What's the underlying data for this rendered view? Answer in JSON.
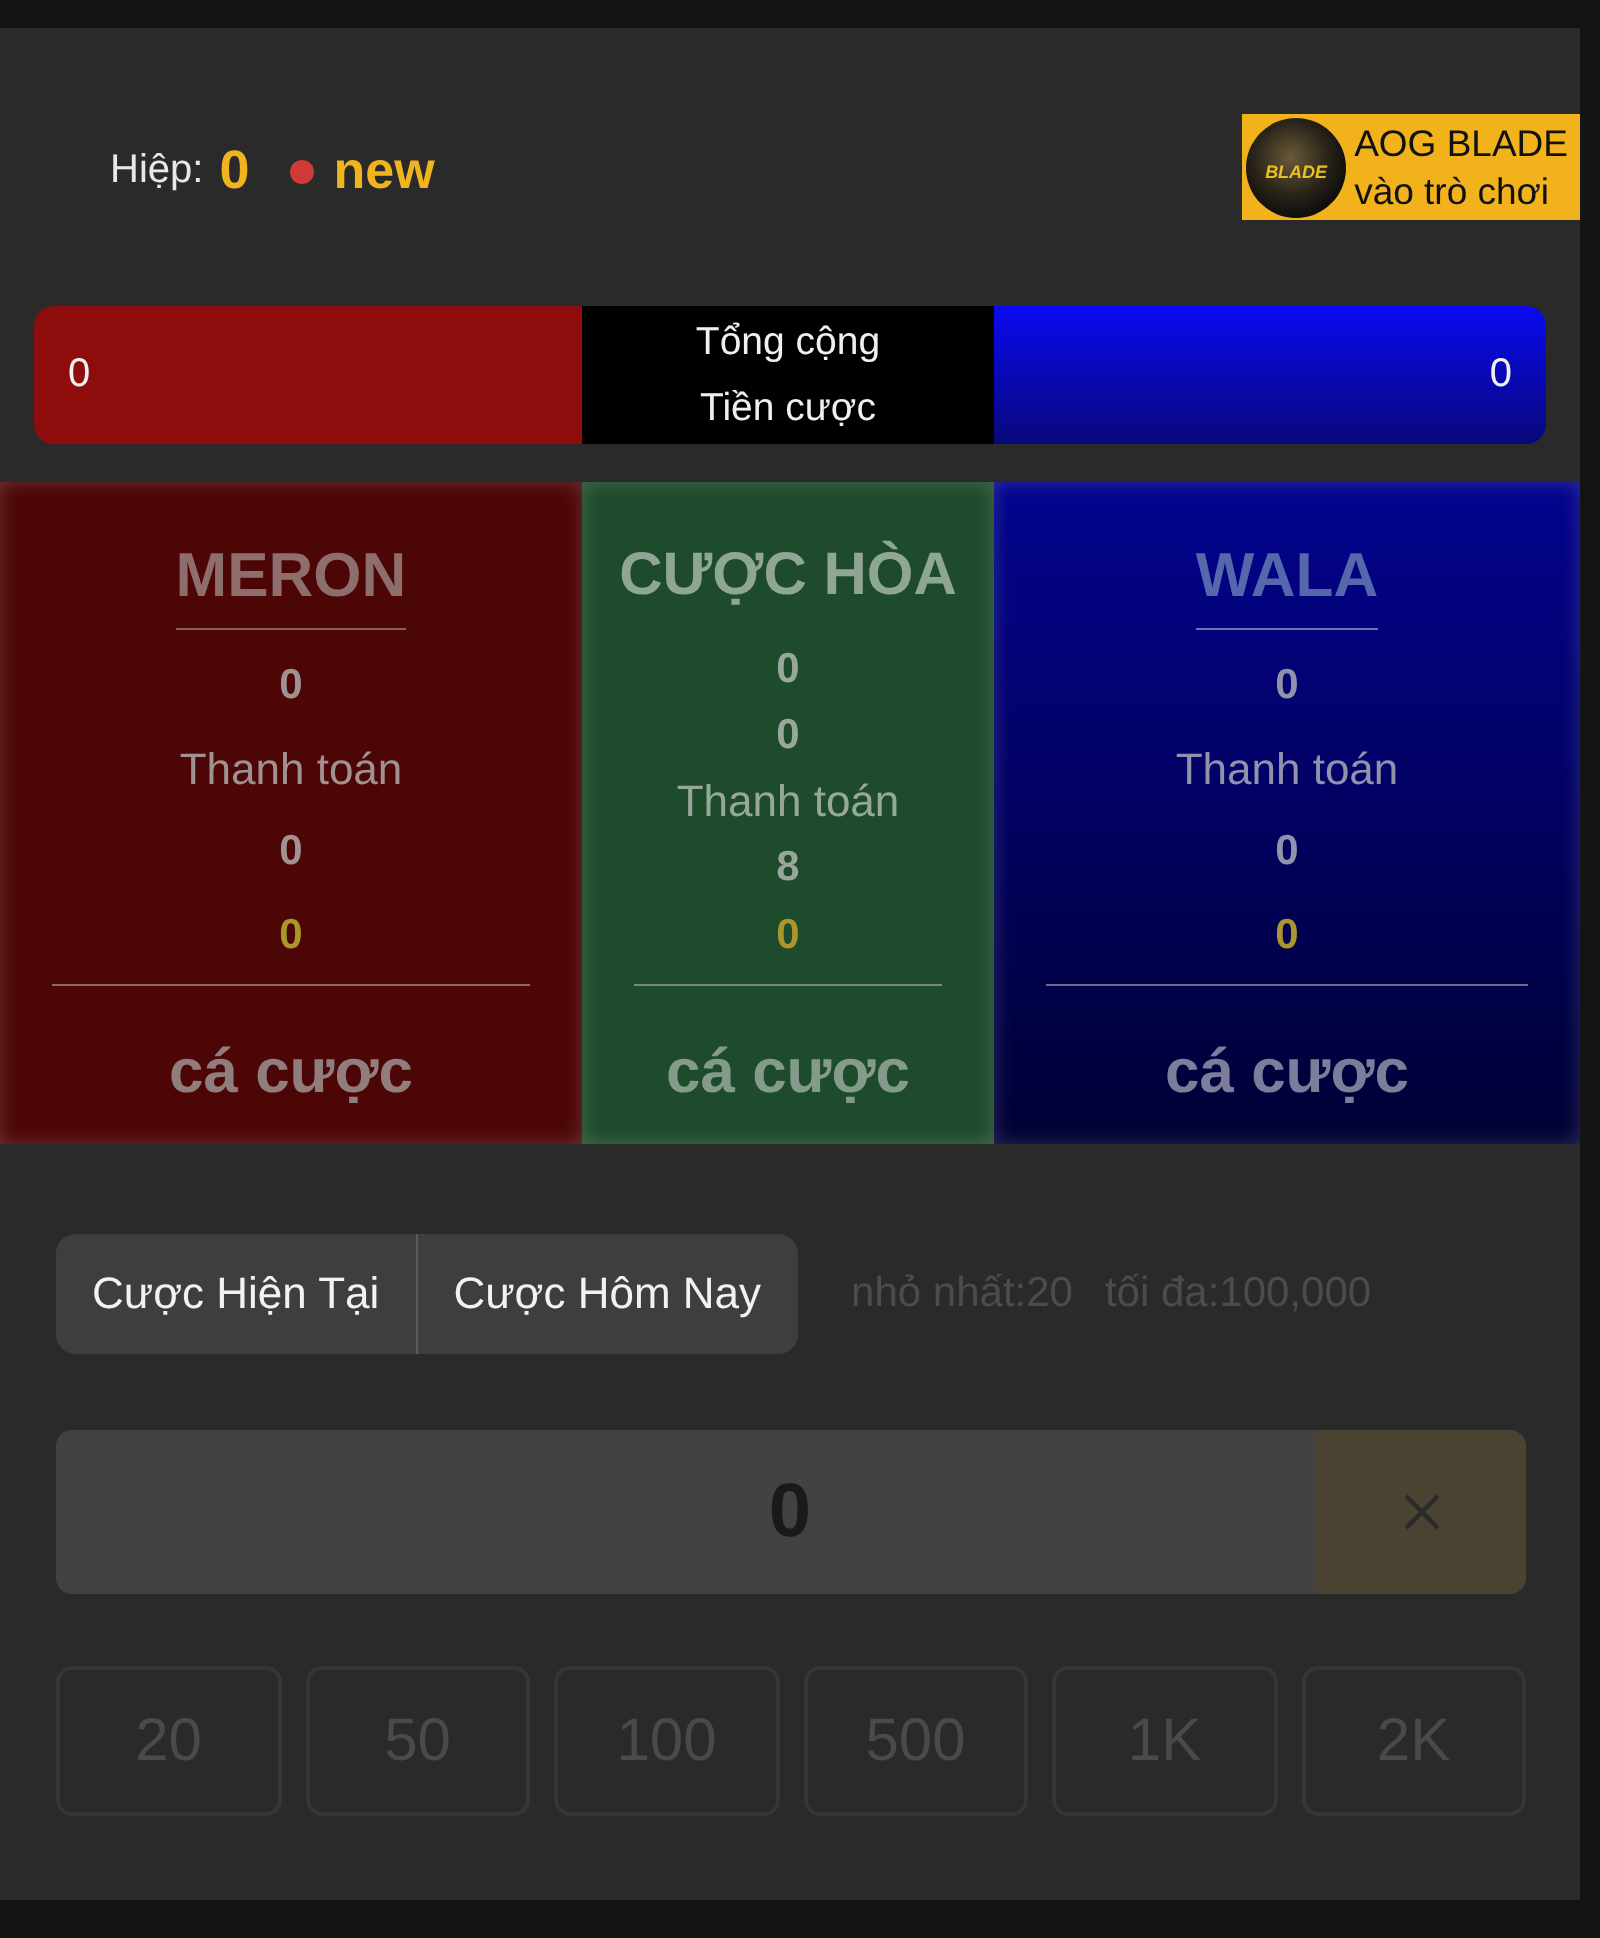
{
  "header": {
    "round_label": "Hiệp:",
    "round_number": "0",
    "status": "new",
    "game_link": {
      "logo_text": "BLADE",
      "title": "AOG BLADE",
      "subtitle": "vào trò chơi"
    }
  },
  "totals": {
    "meron": "0",
    "label_line1": "Tổng cộng",
    "label_line2": "Tiền cược",
    "wala": "0"
  },
  "bet_panels": {
    "disabled": true,
    "columns": [
      {
        "kind": "meron",
        "title": "MERON",
        "underlined": true,
        "amounts": [
          "0"
        ],
        "payout_label": "Thanh toán",
        "payout": "0",
        "my_bet": "0",
        "action": "cá cược"
      },
      {
        "kind": "draw",
        "title": "CƯỢC HÒA",
        "underlined": false,
        "amounts": [
          "0",
          "0"
        ],
        "payout_label": "Thanh toán",
        "payout": "8",
        "my_bet": "0",
        "action": "cá cược"
      },
      {
        "kind": "wala",
        "title": "WALA",
        "underlined": true,
        "amounts": [
          "0"
        ],
        "payout_label": "Thanh toán",
        "payout": "0",
        "my_bet": "0",
        "action": "cá cược"
      }
    ]
  },
  "history_buttons": [
    {
      "label": "Cược Hiện Tại"
    },
    {
      "label": "Cược Hôm Nay"
    }
  ],
  "limits": {
    "min": "nhỏ nhất:20",
    "max": "tối đa:100,000"
  },
  "amount_field": {
    "value": "0"
  },
  "chips": [
    {
      "label": "20",
      "disabled": true
    },
    {
      "label": "50",
      "disabled": true
    },
    {
      "label": "100",
      "disabled": true
    },
    {
      "label": "500",
      "disabled": true
    },
    {
      "label": "1K",
      "disabled": true
    },
    {
      "label": "2K",
      "disabled": true
    }
  ]
}
